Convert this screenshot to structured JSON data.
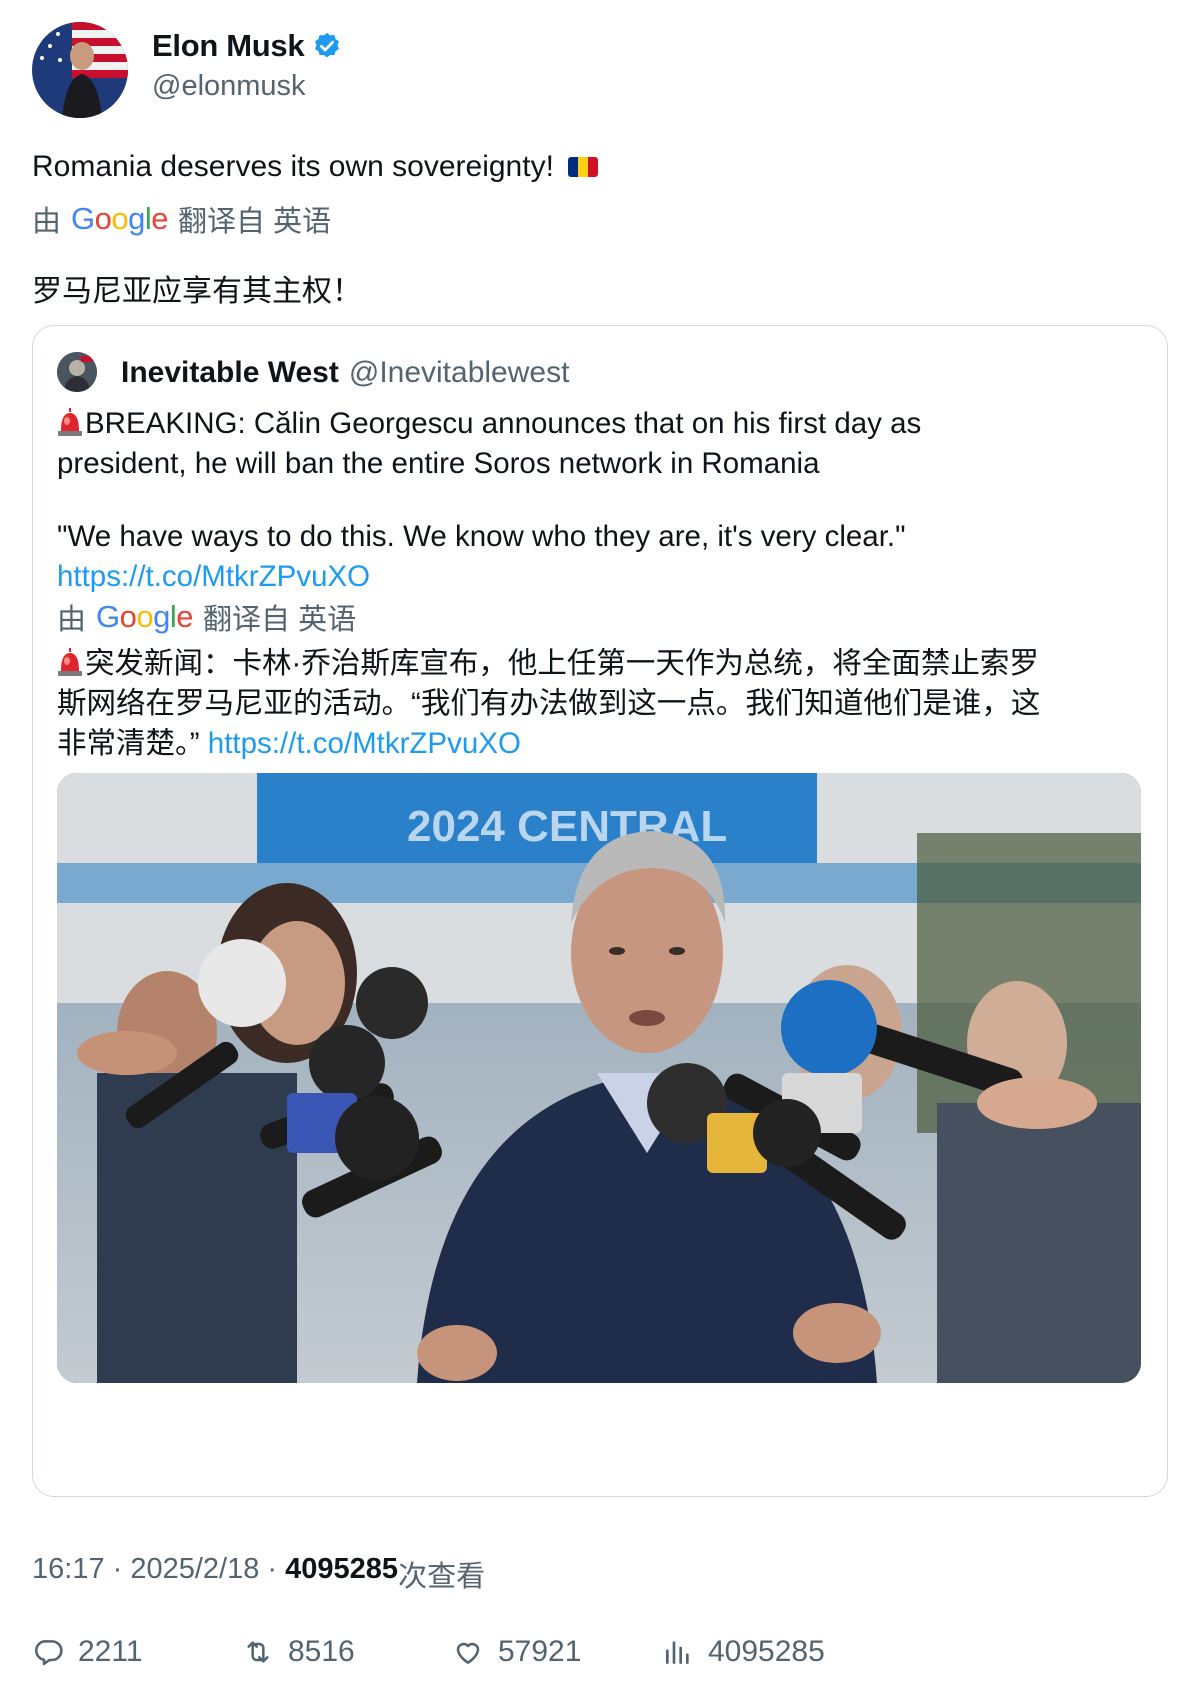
{
  "author": {
    "name": "Elon Musk",
    "handle": "@elonmusk",
    "verified": true
  },
  "tweet": {
    "text": "Romania deserves its own sovereignty!",
    "flag_emoji": "romania-flag",
    "translation_prefix": "由",
    "translation_provider": "Google",
    "translation_suffix": "翻译自 英语",
    "translated_text": "罗马尼亚应享有其主权！"
  },
  "quoted": {
    "name": "Inevitable West",
    "handle": "@Inevitablewest",
    "line1": "BREAKING: Călin Georgescu announces that on his first day as",
    "line2": "president, he will ban the entire Soros network in Romania",
    "quote_line": "\"We have ways to do this. We know who they are, it's very clear.\"",
    "link": "https://t.co/MtkrZPvuXO",
    "translation_prefix": "由",
    "translation_provider": "Google",
    "translation_suffix": "翻译自 英语",
    "trans_line1": "突发新闻：卡林·乔治斯库宣布，他上任第一天作为总统，将全面禁止索罗",
    "trans_line2": "斯网络在罗马尼亚的活动。“我们有办法做到这一点。我们知道他们是谁，这",
    "trans_line3": "非常清楚。”",
    "trans_link": "https://t.co/MtkrZPvuXO",
    "photo_banner_text": "2024 CENTRAL"
  },
  "meta": {
    "time": "16:17",
    "date": "2025/2/18",
    "views": "4095285",
    "views_label": "次查看"
  },
  "actions": {
    "replies": "2211",
    "retweets": "8516",
    "likes": "57921",
    "views": "4095285"
  },
  "colors": {
    "link": "#1d9bf0",
    "secondary_text": "#536471",
    "verified_badge": "#1d9bf0",
    "border": "#cfd9de"
  }
}
